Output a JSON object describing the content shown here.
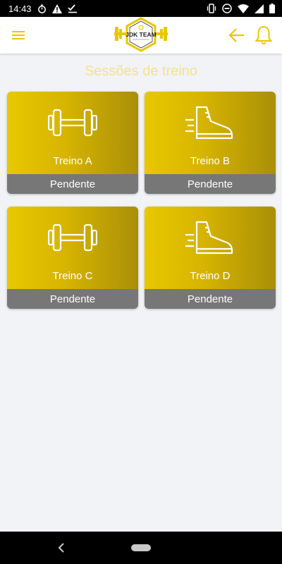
{
  "status_bar": {
    "time": "14:43"
  },
  "header": {
    "menu_icon": "hamburger-menu-icon",
    "logo_text": "JDK TEAM",
    "back_icon": "arrow-left-icon",
    "notification_icon": "bell-icon"
  },
  "section": {
    "title": "Sessões de treino"
  },
  "cards": [
    {
      "label": "Treino A",
      "status": "Pendente",
      "icon": "dumbbell-icon"
    },
    {
      "label": "Treino B",
      "status": "Pendente",
      "icon": "running-shoe-icon"
    },
    {
      "label": "Treino C",
      "status": "Pendente",
      "icon": "dumbbell-icon"
    },
    {
      "label": "Treino D",
      "status": "Pendente",
      "icon": "running-shoe-icon"
    }
  ],
  "colors": {
    "accent": "#e6c800",
    "status_bg": "#777777",
    "title": "#f2e28a",
    "background": "#f2f3f7"
  }
}
